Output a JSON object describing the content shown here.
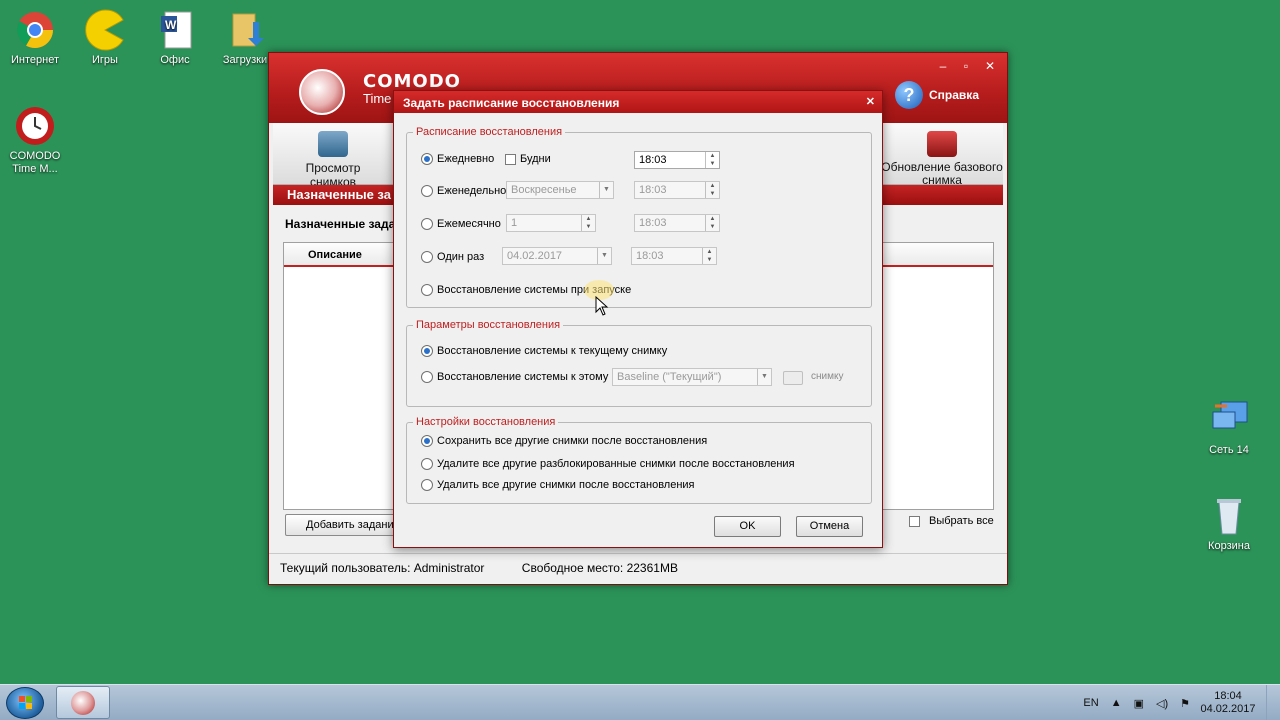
{
  "desktop": {
    "icons_top": [
      {
        "label": "Интернет",
        "icon": "chrome-icon"
      },
      {
        "label": "Игры",
        "icon": "games-icon"
      },
      {
        "label": "Офис",
        "icon": "word-icon"
      },
      {
        "label": "Загрузки",
        "icon": "downloads-folder-icon"
      }
    ],
    "comodo_icon": {
      "label1": "COMODO",
      "label2": "Time M..."
    },
    "network_icon": {
      "label": "Сеть 14"
    },
    "recycle_icon": {
      "label": "Корзина"
    }
  },
  "main_window": {
    "brand": "COMODO",
    "brand_sub": "Time",
    "help_label": "Справка",
    "toolbar": {
      "snapshots_label": "Просмотр снимков",
      "update_base_label_1": "Обновление базового",
      "update_base_label_2": "снимка"
    },
    "section_bar": "Назначенные за",
    "section_title": "Назначенные задан",
    "list_header": "Описание",
    "add_task_button": "Добавить задание",
    "select_all_label": "Выбрать все",
    "status": {
      "current_user": "Текущий пользователь: Administrator",
      "free_space": "Свободное место: 22361MB"
    }
  },
  "dialog": {
    "title": "Задать расписание восстановления",
    "schedule_group": {
      "legend": "Расписание восстановления",
      "daily": {
        "label": "Ежедневно",
        "selected": true
      },
      "weekdays_label": "Будни",
      "daily_time": "18:03",
      "weekly": {
        "label": "Еженедельно",
        "selected": false
      },
      "weekly_day": "Воскресенье",
      "weekly_time": "18:03",
      "monthly": {
        "label": "Ежемесячно",
        "selected": false
      },
      "monthly_day": "1",
      "monthly_time": "18:03",
      "once": {
        "label": "Один раз",
        "selected": false
      },
      "once_date": "04.02.2017",
      "once_time": "18:03",
      "on_startup_label": "Восстановление системы при запуске"
    },
    "params_group": {
      "legend": "Параметры восстановления",
      "to_current": {
        "label": "Восстановление системы к текущему снимку",
        "selected": true
      },
      "to_this": {
        "label": "Восстановление системы к этому",
        "selected": false
      },
      "snapshot_select": "Baseline (\"Текущий\")",
      "snapshot_suffix": "снимку"
    },
    "settings_group": {
      "legend": "Настройки восстановления",
      "keep_all": {
        "label": "Сохранить все другие снимки после восстановления",
        "selected": true
      },
      "delete_unlocked": {
        "label": "Удалите все другие разблокированные снимки после восстановления",
        "selected": false
      },
      "delete_all": {
        "label": "Удалить все другие снимки после восстановления",
        "selected": false
      }
    },
    "ok_button": "OK",
    "cancel_button": "Отмена"
  },
  "taskbar": {
    "language": "EN",
    "time": "18:04",
    "date": "04.02.2017"
  },
  "colors": {
    "desktop": "#2b9358",
    "accent_red": "#c02020",
    "radio_selected": "#2a70c9"
  }
}
